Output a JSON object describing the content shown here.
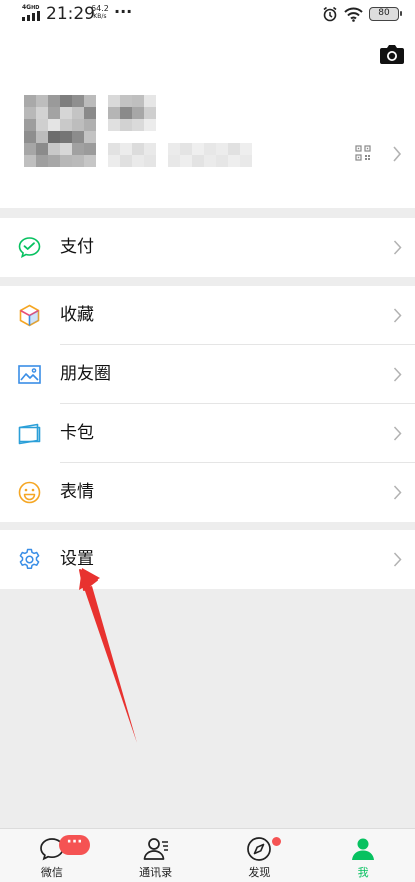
{
  "status_bar": {
    "network": "4G",
    "network_sup": "HD",
    "time": "21:29",
    "speed_value": "64.2",
    "speed_unit": "KB/s",
    "more": "···",
    "battery": "80"
  },
  "profile": {
    "icons": [
      "camera-icon",
      "qr-code-icon",
      "chevron-right-icon"
    ]
  },
  "menu": {
    "pay": {
      "label": "支付",
      "icon": "wechat-pay-icon"
    },
    "favorites": {
      "label": "收藏",
      "icon": "favorites-cube-icon"
    },
    "moments": {
      "label": "朋友圈",
      "icon": "moments-photo-icon"
    },
    "cards": {
      "label": "卡包",
      "icon": "card-wallet-icon"
    },
    "stickers": {
      "label": "表情",
      "icon": "smiley-icon"
    },
    "settings": {
      "label": "设置",
      "icon": "gear-icon"
    }
  },
  "tab_bar": {
    "tabs": [
      {
        "label": "微信",
        "icon": "chat-bubble-icon",
        "active": false
      },
      {
        "label": "通讯录",
        "icon": "contacts-icon",
        "active": false
      },
      {
        "label": "发现",
        "icon": "compass-icon",
        "active": false
      },
      {
        "label": "我",
        "icon": "person-icon",
        "active": true
      }
    ],
    "chat_badge": "···"
  },
  "colors": {
    "accent_green": "#07c160",
    "badge_red": "#f55353",
    "annotation_red": "#e8322f",
    "background": "#ededed"
  }
}
